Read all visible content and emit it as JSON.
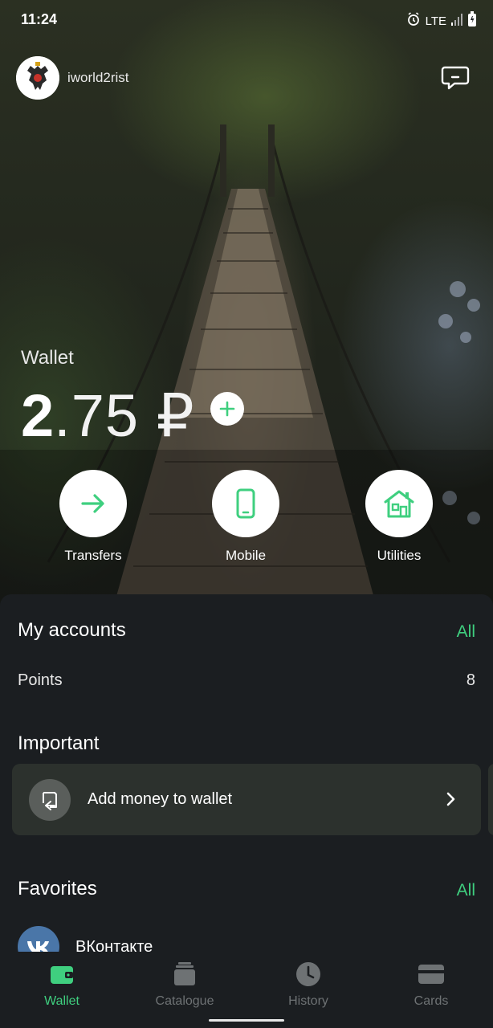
{
  "status_bar": {
    "time": "11:24",
    "network": "LTE"
  },
  "header": {
    "username": "iworld2rist"
  },
  "wallet": {
    "label": "Wallet",
    "balance_integer": "2",
    "balance_fraction": ".75 ₽"
  },
  "quick_actions": [
    {
      "label": "Transfers",
      "icon": "arrow-right-icon"
    },
    {
      "label": "Mobile",
      "icon": "phone-icon"
    },
    {
      "label": "Utilities",
      "icon": "house-icon"
    }
  ],
  "accounts": {
    "title": "My accounts",
    "all_label": "All",
    "rows": [
      {
        "label": "Points",
        "value": "8"
      }
    ]
  },
  "important": {
    "title": "Important",
    "card_text": "Add money to wallet"
  },
  "favorites": {
    "title": "Favorites",
    "all_label": "All",
    "items": [
      {
        "name": "ВКонтакте"
      }
    ]
  },
  "bottom_nav": [
    {
      "label": "Wallet",
      "active": true
    },
    {
      "label": "Catalogue",
      "active": false
    },
    {
      "label": "History",
      "active": false
    },
    {
      "label": "Cards",
      "active": false
    }
  ],
  "colors": {
    "accent": "#3fcf7f",
    "background": "#1b1e21",
    "card": "#2c312d"
  }
}
